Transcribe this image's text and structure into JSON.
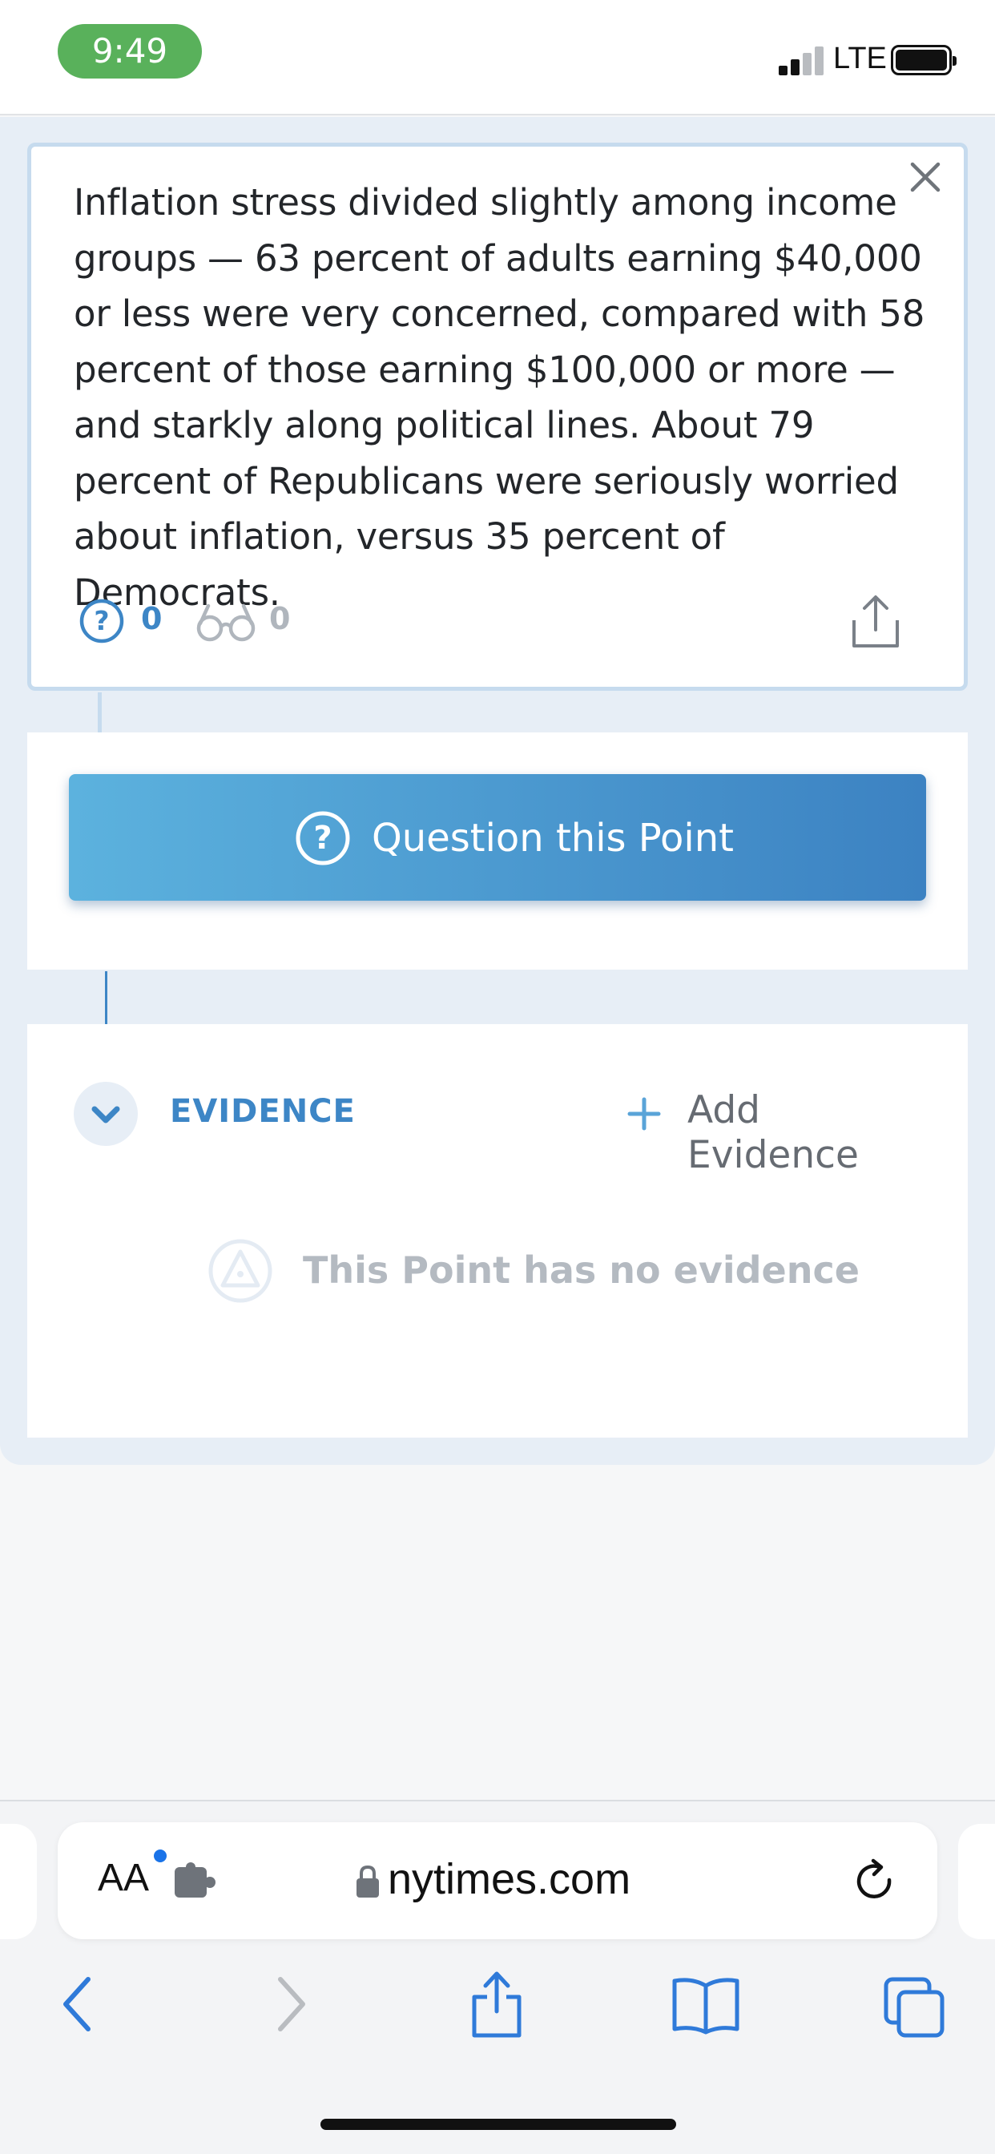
{
  "status_bar": {
    "time": "9:49",
    "network": "LTE",
    "signal_bars_active": 2,
    "signal_bars_total": 4,
    "battery_level": 1.0,
    "time_pill_color": "#59b15b"
  },
  "point": {
    "text": "Inflation stress divided slightly among income groups — 63 percent of adults earning $40,000 or less were very concerned, compared with 58 percent of those earning $100,000 or more — and starkly along political lines. About 79 percent of Republicans were seriously worried about inflation, versus 35 percent of Democrats.",
    "question_count": "0",
    "view_count": "0",
    "icons": {
      "close": "close-icon",
      "questions": "question-circle-icon",
      "views": "glasses-icon",
      "share": "share-icon"
    }
  },
  "question_button": {
    "label": "Question this Point",
    "icon": "question-circle-icon"
  },
  "evidence": {
    "title": "EVIDENCE",
    "add_label": "Add Evidence",
    "empty_text": "This Point has no evidence",
    "icons": {
      "toggle": "chevron-down-icon",
      "add": "plus-icon",
      "empty": "evidence-icon"
    }
  },
  "browser": {
    "reader_label": "AA",
    "url": "nytimes.com",
    "icons": {
      "extension": "puzzle-icon",
      "lock": "lock-icon",
      "reload": "reload-icon",
      "back": "back-chevron-icon",
      "forward": "forward-chevron-icon",
      "share": "share-icon",
      "bookmarks": "book-icon",
      "tabs": "tabs-icon"
    }
  },
  "colors": {
    "accent_blue": "#3d86c6",
    "panel_background": "#e7eef6",
    "card_border": "#c6dbee",
    "button_gradient_start": "#5cb2de",
    "button_gradient_end": "#3c82c2",
    "safari_blue": "#2f7ad9"
  }
}
